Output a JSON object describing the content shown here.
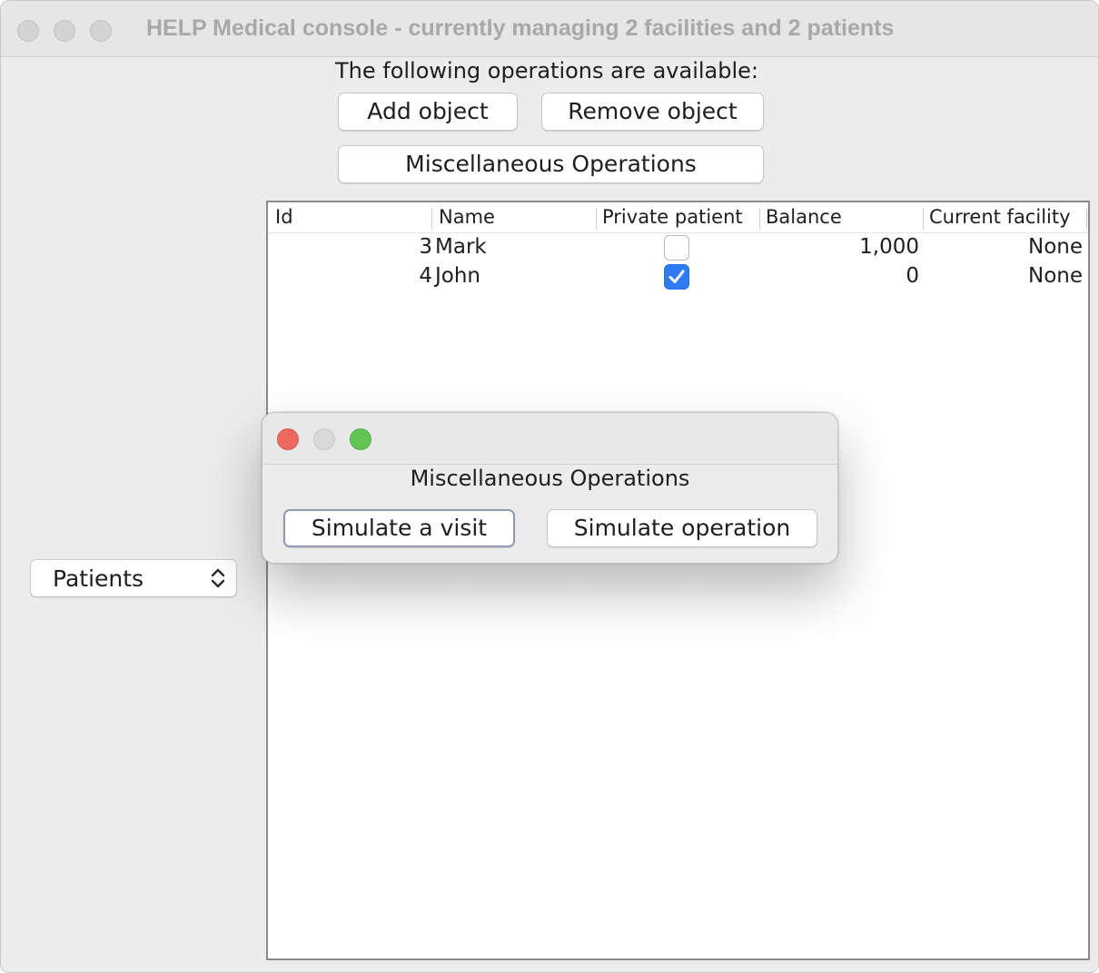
{
  "window": {
    "title": "HELP Medical console - currently managing 2 facilities and 2 patients"
  },
  "operations": {
    "label": "The following operations are available:",
    "add_label": "Add object",
    "remove_label": "Remove object",
    "misc_label": "Miscellaneous Operations"
  },
  "table": {
    "columns": [
      "Id",
      "Name",
      "Private patient",
      "Balance",
      "Current facility"
    ],
    "rows": [
      {
        "id": "3",
        "name": "Mark",
        "private": false,
        "balance": "1,000",
        "facility": "None"
      },
      {
        "id": "4",
        "name": "John",
        "private": true,
        "balance": "0",
        "facility": "None"
      }
    ]
  },
  "type_selector": {
    "value": "Patients"
  },
  "dialog": {
    "heading": "Miscellaneous Operations",
    "visit_label": "Simulate a visit",
    "operation_label": "Simulate operation"
  },
  "colors": {
    "close": "#ed6a5e",
    "minimize": "#d9d9d9",
    "zoom": "#61c554",
    "checkbox_checked": "#2f7bf5"
  }
}
